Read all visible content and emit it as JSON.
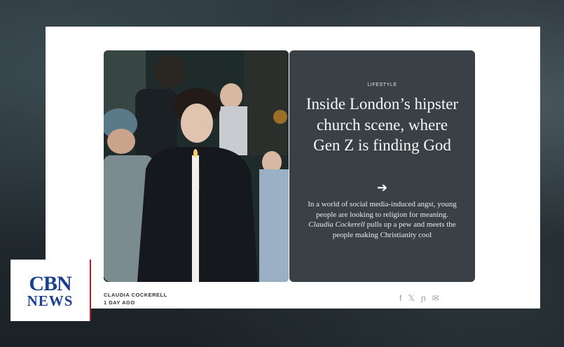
{
  "article": {
    "kicker": "LIFESTYLE",
    "headline": "Inside London’s hipster church scene, where Gen Z is finding God",
    "arrow": "➔",
    "dek_before": "In a world of social media-induced angst, young people are looking to religion for meaning.",
    "dek_author": "Claudia Cockerell",
    "dek_after": "pulls up a pew and meets the people making Christianity cool",
    "byline_author": "CLAUDIA COCKERELL",
    "byline_time": "1 DAY AGO"
  },
  "share": {
    "facebook": "f",
    "x": "𝕏",
    "threads": "ɲ",
    "email": "✉"
  },
  "logo": {
    "top": "CBN",
    "bottom": "NEWS"
  },
  "colors": {
    "panel": "#3a4146",
    "logo_blue": "#1b3f8f",
    "logo_red": "#b01c2a"
  }
}
